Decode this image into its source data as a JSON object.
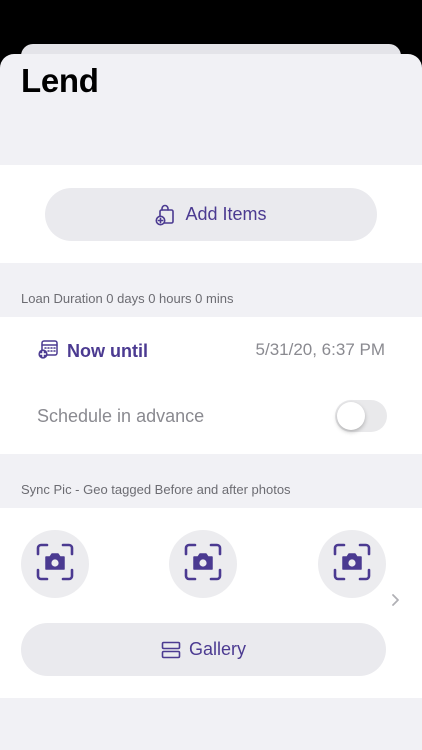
{
  "page": {
    "title": "Lend"
  },
  "add_items": {
    "label": "Add Items",
    "icon": "bag-plus-icon"
  },
  "loan_duration": {
    "text": "Loan Duration 0 days 0 hours 0 mins"
  },
  "schedule": {
    "now_until_label": "Now until",
    "now_until_icon": "calendar-plus-icon",
    "end_datetime": "5/31/20, 6:37 PM",
    "advance_label": "Schedule in advance",
    "advance_enabled": false
  },
  "sync_pic": {
    "caption": "Sync Pic - Geo tagged Before and after photos",
    "camera_icon": "camera-icon",
    "gallery_label": "Gallery",
    "gallery_icon": "gallery-icon"
  },
  "colors": {
    "accent": "#4b3a91",
    "background": "#f1f1f5",
    "secondary_text": "#8a8a90"
  }
}
